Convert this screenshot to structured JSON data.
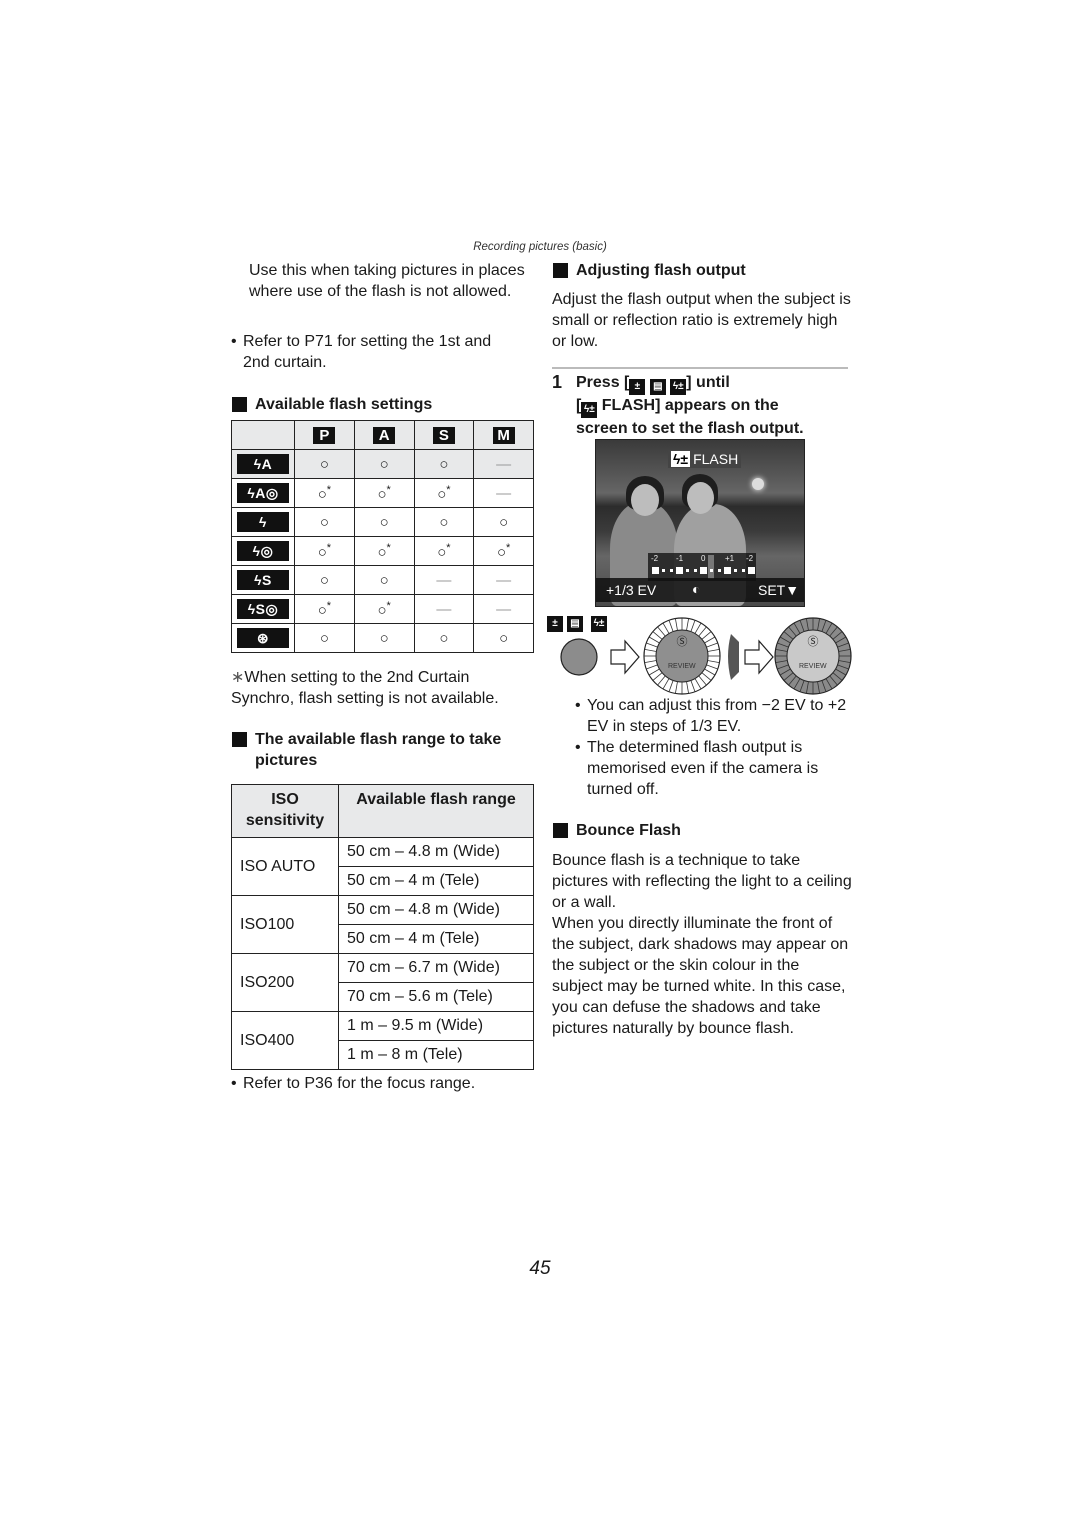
{
  "running_head": "Recording pictures (basic)",
  "page_number": "45",
  "left_column": {
    "intro_text": "Use this when taking pictures in places where use of the flash is not allowed.",
    "intro_bullet": "Refer to P71 for setting the 1st and 2nd curtain.",
    "flash_settings": {
      "heading": "Available flash settings",
      "mode_headers": [
        "P",
        "A",
        "S",
        "M"
      ],
      "rows": [
        {
          "icon": "flash-auto-icon",
          "label": "ϟA",
          "values": [
            "○",
            "○",
            "○",
            "—"
          ],
          "asterisk": [
            false,
            false,
            false,
            false
          ]
        },
        {
          "icon": "flash-auto-red-eye-icon",
          "label": "ϟA◎",
          "values": [
            "○",
            "○",
            "○",
            "—"
          ],
          "asterisk": [
            true,
            true,
            true,
            false
          ]
        },
        {
          "icon": "flash-forced-on-icon",
          "label": "ϟ",
          "values": [
            "○",
            "○",
            "○",
            "○"
          ],
          "asterisk": [
            false,
            false,
            false,
            false
          ]
        },
        {
          "icon": "flash-forced-on-red-eye-icon",
          "label": "ϟ◎",
          "values": [
            "○",
            "○",
            "○",
            "○"
          ],
          "asterisk": [
            true,
            true,
            true,
            true
          ]
        },
        {
          "icon": "flash-slow-sync-icon",
          "label": "ϟS",
          "values": [
            "○",
            "○",
            "—",
            "—"
          ],
          "asterisk": [
            false,
            false,
            false,
            false
          ]
        },
        {
          "icon": "flash-slow-sync-red-eye-icon",
          "label": "ϟS◎",
          "values": [
            "○",
            "○",
            "—",
            "—"
          ],
          "asterisk": [
            true,
            true,
            false,
            false
          ]
        },
        {
          "icon": "flash-forced-off-icon",
          "label": "⊛",
          "values": [
            "○",
            "○",
            "○",
            "○"
          ],
          "asterisk": [
            false,
            false,
            false,
            false
          ]
        }
      ],
      "asterisk_mark": "*",
      "footnote_mark": "∗",
      "footnote": "When setting to the 2nd Curtain Synchro, flash setting is not available."
    },
    "flash_range": {
      "heading": "The available flash range to take pictures",
      "col_headers": [
        "ISO sensitivity",
        "Available flash range"
      ],
      "groups": [
        {
          "iso": "ISO AUTO",
          "ranges": [
            "50 cm – 4.8 m (Wide)",
            "50 cm – 4 m (Tele)"
          ]
        },
        {
          "iso": "ISO100",
          "ranges": [
            "50 cm – 4.8 m (Wide)",
            "50 cm – 4 m (Tele)"
          ]
        },
        {
          "iso": "ISO200",
          "ranges": [
            "70 cm – 6.7 m (Wide)",
            "70 cm – 5.6 m (Tele)"
          ]
        },
        {
          "iso": "ISO400",
          "ranges": [
            "1 m – 9.5 m (Wide)",
            "1 m – 8 m (Tele)"
          ]
        }
      ],
      "bullet": "Refer to P36 for the focus range."
    }
  },
  "right_column": {
    "adjust": {
      "heading": "Adjusting flash output",
      "text": "Adjust the flash output when the subject is small or reflection ratio is extremely high or low."
    },
    "step1": {
      "number": "1",
      "press": "Press [",
      "until": "] until",
      "line2_open": "[",
      "line2_rest": " FLASH] appears on the",
      "line3": "screen to set the flash output."
    },
    "lcd": {
      "title": "FLASH",
      "title_icon": "ϟ±",
      "scale_labels": [
        "-2",
        "-1",
        "0",
        "+1",
        "-2"
      ],
      "ev_value": "+1/3 EV",
      "set_label": "SET▼",
      "current_step_fraction_of_range": 0.5833
    },
    "diagram": {
      "review_label_1": "REVIEW",
      "review_label_2": "REVIEW"
    },
    "bullets": [
      "You can adjust this from −2 EV to +2 EV in steps of 1/3 EV.",
      "The determined flash output is memorised even if the camera is turned off."
    ],
    "bounce": {
      "heading": "Bounce Flash",
      "para1": "Bounce flash is a technique to take pictures with reflecting the light to a ceiling or a wall.",
      "para2": "When you directly illuminate the front of the subject, dark shadows may appear on the subject or the skin colour in the subject may be turned white. In this case, you can defuse the shadows and take pictures naturally by bounce flash."
    }
  }
}
